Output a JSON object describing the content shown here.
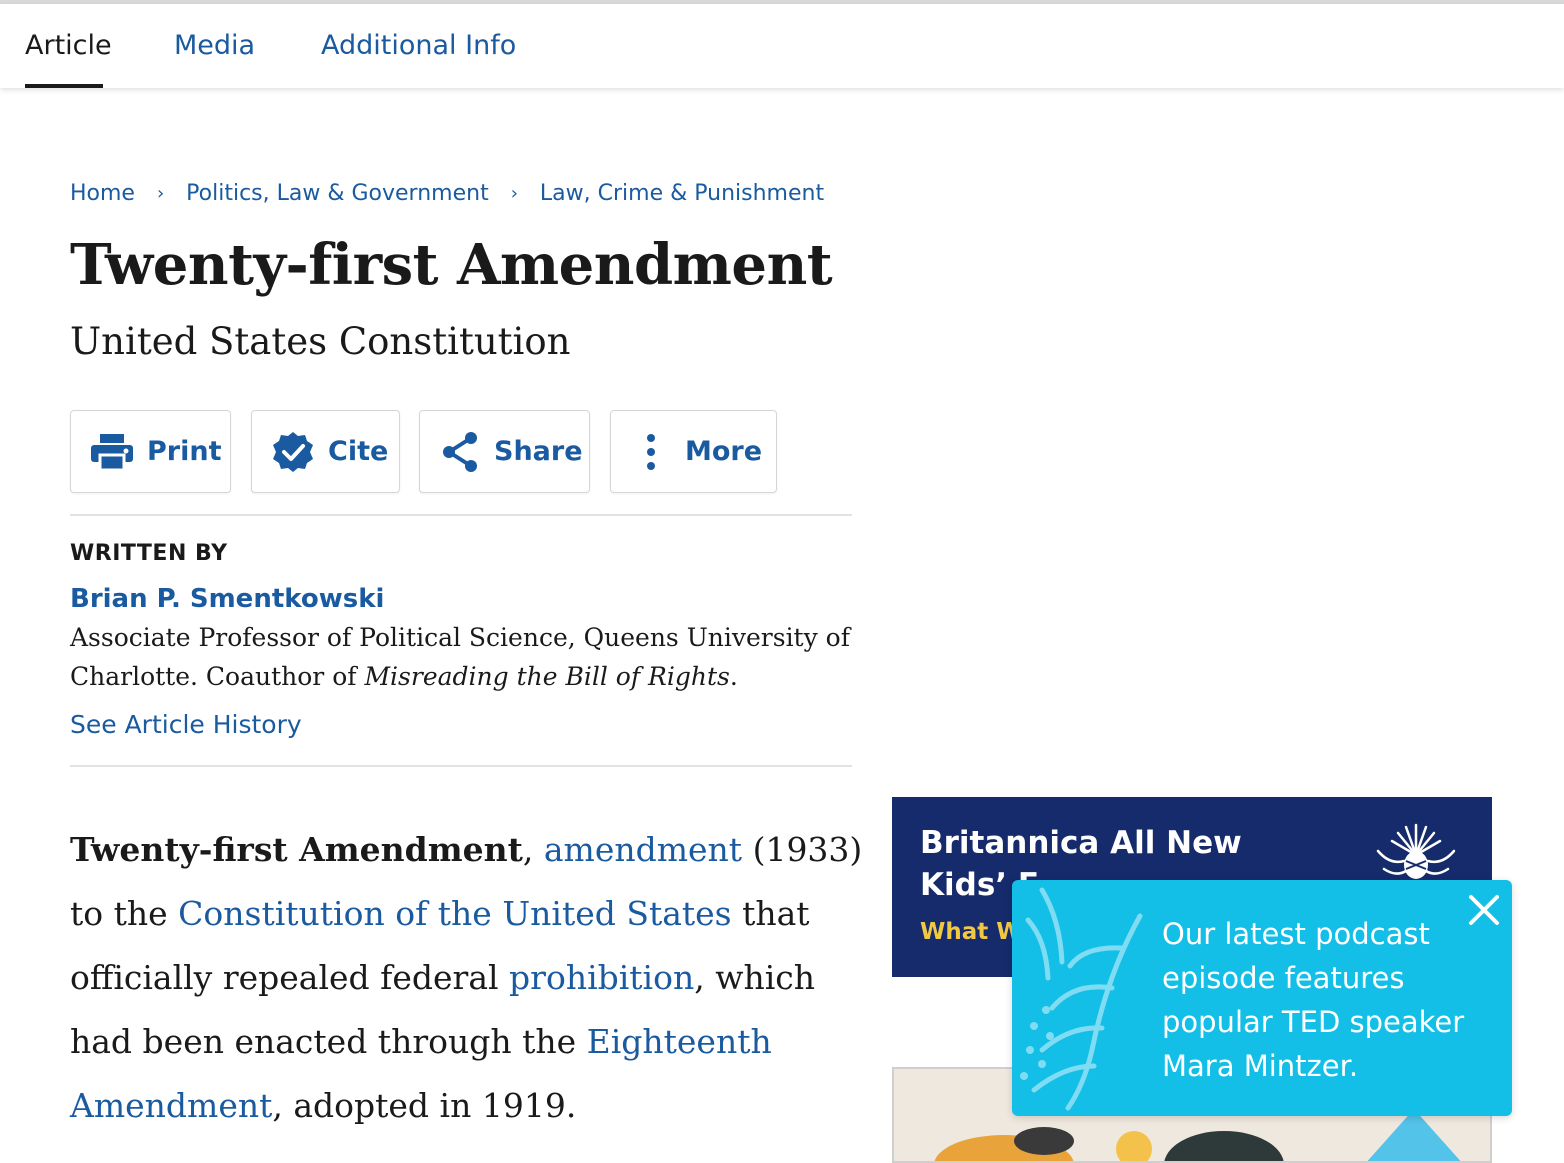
{
  "tabs": [
    {
      "label": "Article",
      "active": true
    },
    {
      "label": "Media",
      "active": false
    },
    {
      "label": "Additional Info",
      "active": false
    }
  ],
  "breadcrumb": [
    "Home",
    "Politics, Law & Government",
    "Law, Crime & Punishment"
  ],
  "breadcrumb_separator": "›",
  "article": {
    "title": "Twenty-first Amendment",
    "subtitle": "United States Constitution"
  },
  "actions": [
    {
      "label": "Print",
      "icon": "print-icon"
    },
    {
      "label": "Cite",
      "icon": "verified-badge-icon"
    },
    {
      "label": "Share",
      "icon": "share-icon"
    },
    {
      "label": "More",
      "icon": "vertical-ellipsis-icon"
    }
  ],
  "author_section": {
    "heading": "WRITTEN BY",
    "name": "Brian P. Smentkowski",
    "bio_prefix": "Associate Professor of Political Science, Queens University of Charlotte. Coauthor of ",
    "bio_book": "Misreading the Bill of Rights",
    "bio_suffix": ".",
    "history_link": "See Article History"
  },
  "intro": {
    "bold_term": "Twenty-first Amendment",
    "t1": ", ",
    "link1": "amendment",
    "t2": " (1933) to the ",
    "link2": "Constitution of the United States",
    "t3": " that officially repealed federal ",
    "link3": "prohibition",
    "t4": ", which had been enacted through the ",
    "link4": "Eighteenth Amendment",
    "t5": ", adopted in 1919."
  },
  "ad": {
    "line1": "Britannica All New",
    "line2": "Kids’ E",
    "line3": "What W"
  },
  "toast": {
    "message": "Our latest podcast episode features popular TED speaker Mara Mintzer."
  },
  "colors": {
    "link": "#1a5aa0",
    "ad_background": "#152b6b",
    "toast_background": "#13bfe6",
    "ad_accent": "#f2c744"
  }
}
